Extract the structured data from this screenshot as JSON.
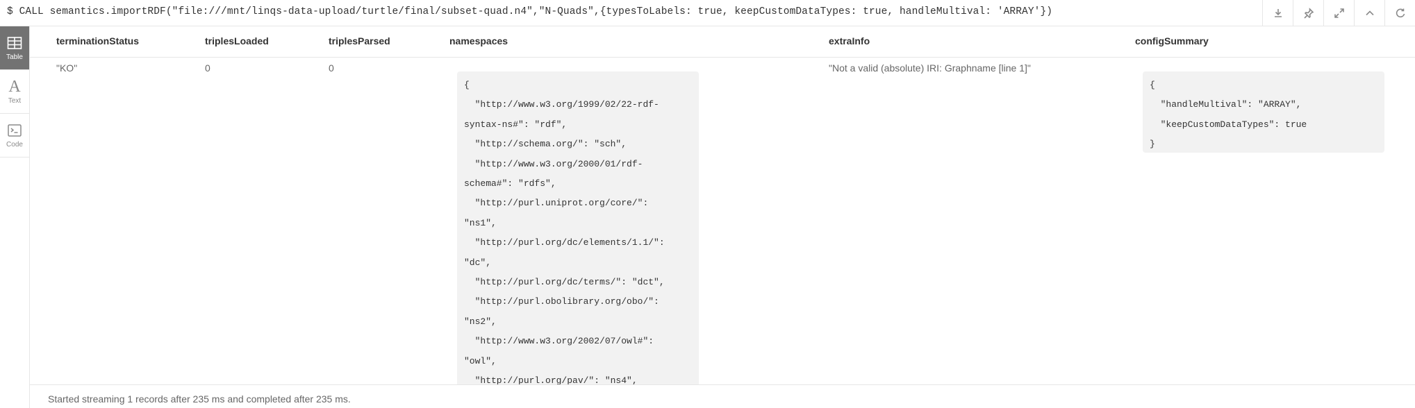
{
  "query": "$ CALL semantics.importRDF(\"file:///mnt/linqs-data-upload/turtle/final/subset-quad.n4\",\"N-Quads\",{typesToLabels: true, keepCustomDataTypes: true, handleMultival: 'ARRAY'})",
  "toolbar": {
    "icons": [
      "download-icon",
      "pin-icon",
      "expand-icon",
      "collapse-icon",
      "rerun-icon"
    ]
  },
  "sidebar": {
    "items": [
      {
        "label": "Table",
        "icon": "table-icon",
        "active": true
      },
      {
        "label": "Text",
        "icon": "text-icon",
        "active": false
      },
      {
        "label": "Code",
        "icon": "code-icon",
        "active": false
      }
    ]
  },
  "table": {
    "columns": [
      "terminationStatus",
      "triplesLoaded",
      "triplesParsed",
      "namespaces",
      "extraInfo",
      "configSummary"
    ],
    "row": {
      "terminationStatus": "\"KO\"",
      "triplesLoaded": "0",
      "triplesParsed": "0",
      "namespaces_lines": [
        "{",
        "  \"http://www.w3.org/1999/02/22-rdf-",
        "syntax-ns#\": \"rdf\",",
        "  \"http://schema.org/\": \"sch\",",
        "  \"http://www.w3.org/2000/01/rdf-",
        "schema#\": \"rdfs\",",
        "  \"http://purl.uniprot.org/core/\":",
        "\"ns1\",",
        "  \"http://purl.org/dc/elements/1.1/\":",
        "\"dc\",",
        "  \"http://purl.org/dc/terms/\": \"dct\",",
        "  \"http://purl.obolibrary.org/obo/\":",
        "\"ns2\",",
        "  \"http://www.w3.org/2002/07/owl#\":",
        "\"owl\",",
        "  \"http://purl.org/pav/\": \"ns4\","
      ],
      "extraInfo": "\"Not a valid (absolute) IRI: Graphname [line 1]\"",
      "configSummary_lines": [
        "{",
        "  \"handleMultival\": \"ARRAY\",",
        "  \"keepCustomDataTypes\": true",
        "}"
      ]
    }
  },
  "status": "Started streaming 1 records after 235 ms and completed after 235 ms."
}
